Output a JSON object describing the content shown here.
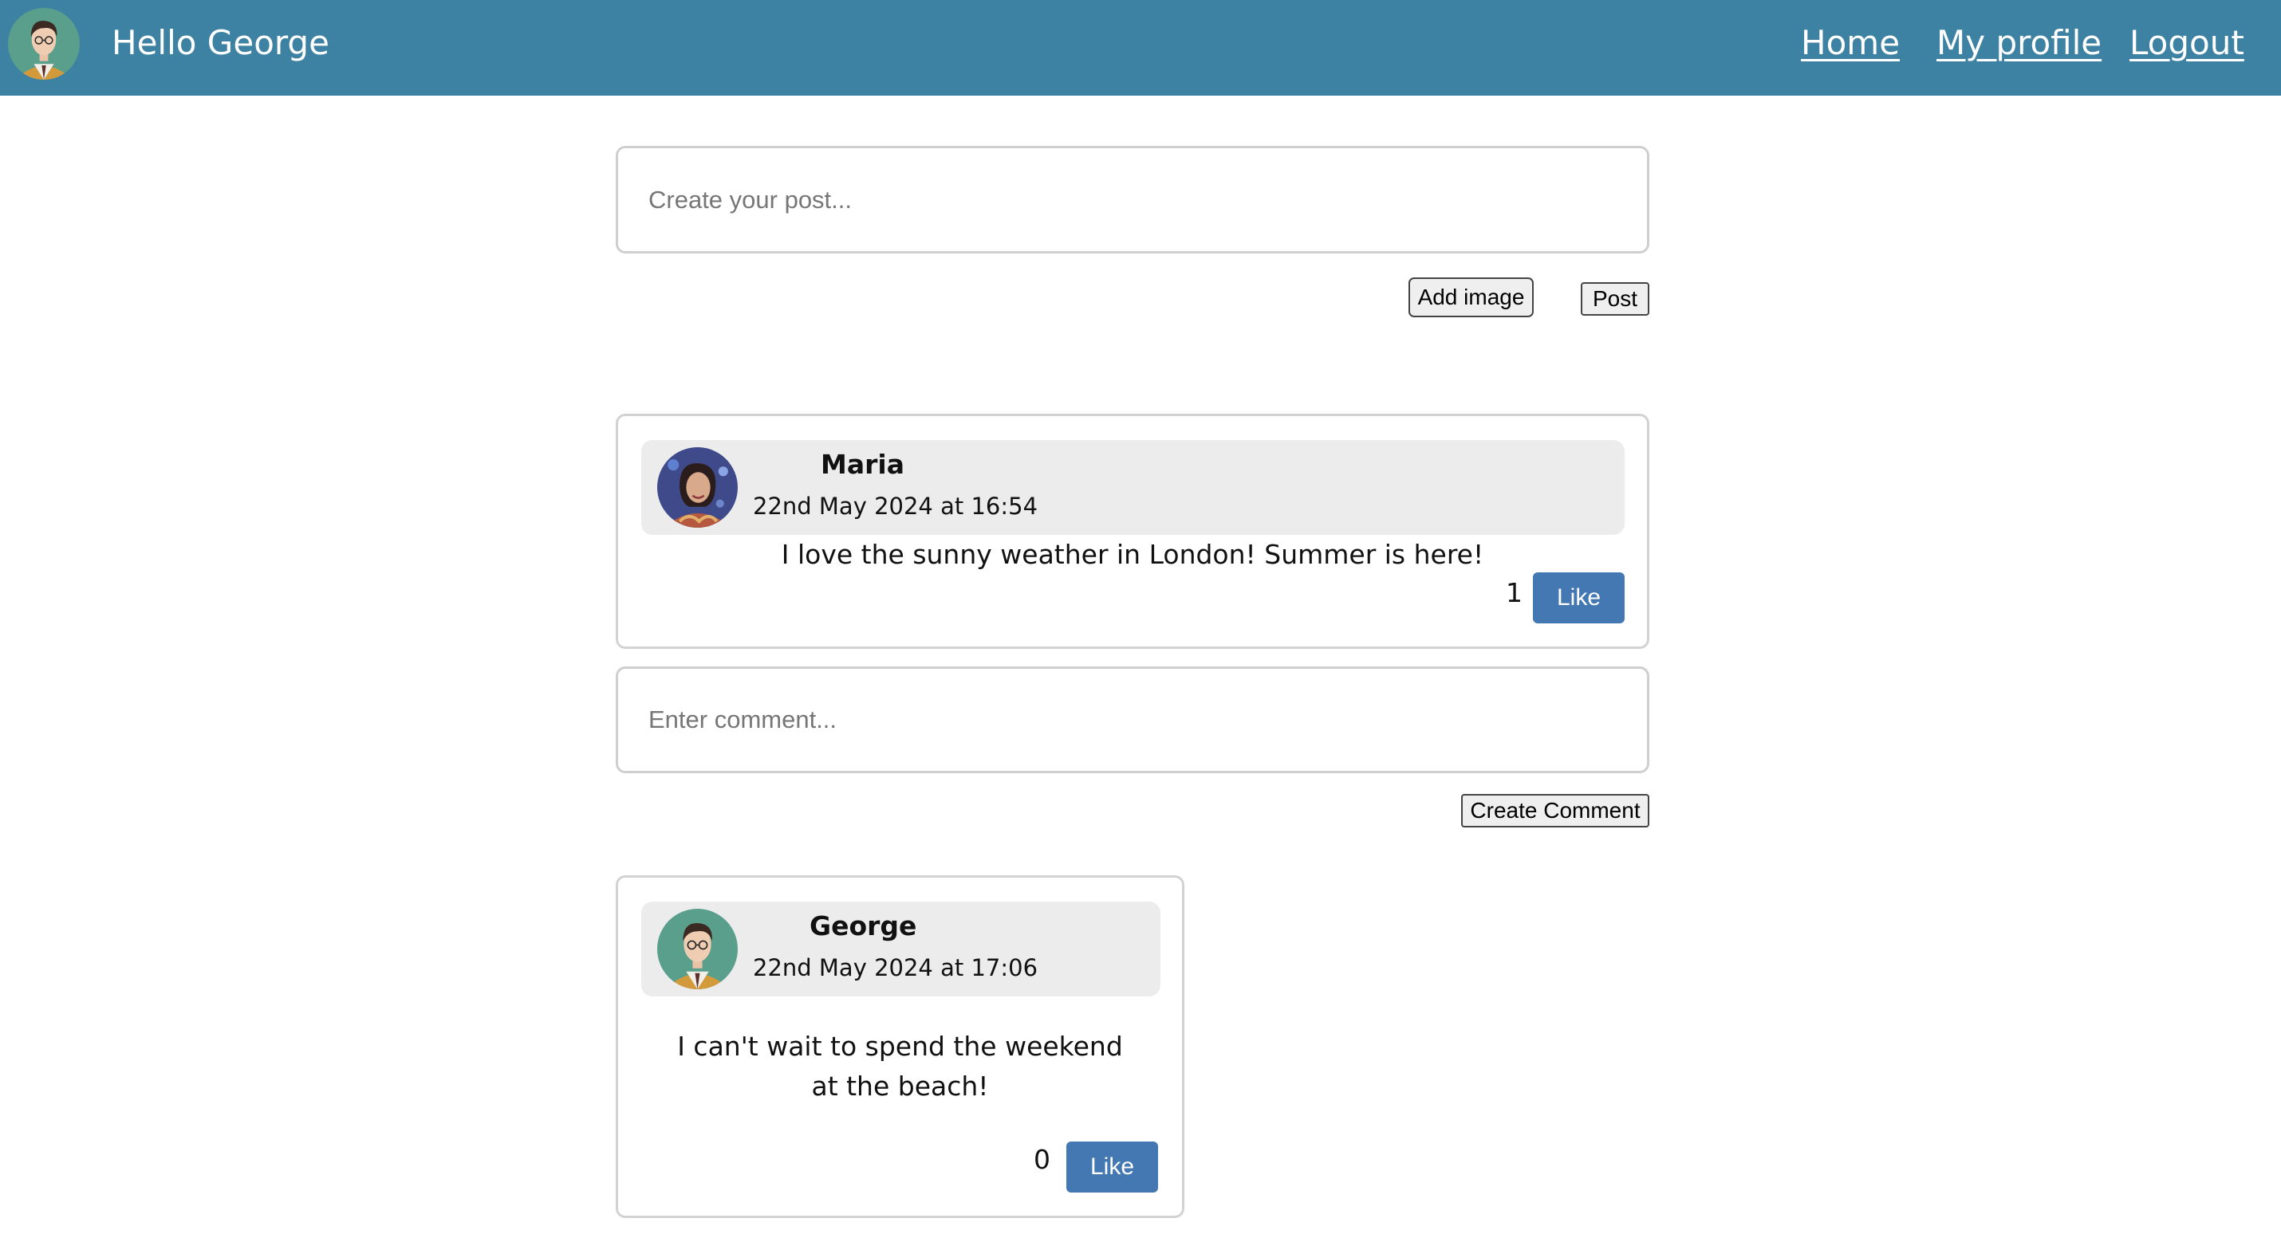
{
  "header": {
    "greeting": "Hello George",
    "avatar_icon": "user-avatar-george",
    "nav": {
      "home": "Home",
      "my_profile": "My profile",
      "logout": "Logout"
    }
  },
  "composer": {
    "placeholder": "Create your post...",
    "add_image_label": "Add image",
    "post_label": "Post"
  },
  "posts": [
    {
      "author": "Maria",
      "timestamp": "22nd May 2024 at 16:54",
      "text": "I love the sunny weather in London! Summer is here!",
      "likes": "1",
      "like_label": "Like"
    }
  ],
  "comment_form": {
    "placeholder": "Enter comment...",
    "submit_label": "Create Comment"
  },
  "comments": [
    {
      "author": "George",
      "timestamp": "22nd May 2024 at 17:06",
      "text": "I can't wait to spend the weekend at the beach!",
      "likes": "0",
      "like_label": "Like"
    }
  ],
  "colors": {
    "header_bg": "#3d82a3",
    "like_button": "#4378b2",
    "card_header_bg": "#ececec"
  }
}
